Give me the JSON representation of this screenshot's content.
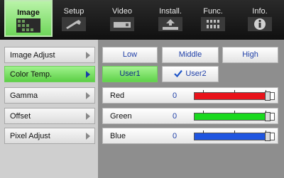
{
  "tabs": [
    {
      "label": "Image",
      "icon": "image-grid-icon",
      "active": true
    },
    {
      "label": "Setup",
      "icon": "wrench-icon",
      "active": false
    },
    {
      "label": "Video",
      "icon": "projector-icon",
      "active": false
    },
    {
      "label": "Install.",
      "icon": "install-tray-icon",
      "active": false
    },
    {
      "label": "Func.",
      "icon": "function-grid-icon",
      "active": false
    },
    {
      "label": "Info.",
      "icon": "info-icon",
      "active": false
    }
  ],
  "menu": [
    {
      "label": "Image Adjust",
      "selected": false
    },
    {
      "label": "Color Temp.",
      "selected": true
    },
    {
      "label": "Gamma",
      "selected": false
    },
    {
      "label": "Offset",
      "selected": false
    },
    {
      "label": "Pixel Adjust",
      "selected": false
    }
  ],
  "presets": {
    "low": "Low",
    "middle": "Middle",
    "high": "High"
  },
  "users": {
    "user1": "User1",
    "user2": "User2",
    "selected": "User1",
    "checked": "User2"
  },
  "sliders": [
    {
      "name": "Red",
      "value": "0",
      "level": 0.92,
      "color": "#e8121a"
    },
    {
      "name": "Green",
      "value": "0",
      "level": 0.92,
      "color": "#19d91e"
    },
    {
      "name": "Blue",
      "value": "0",
      "level": 0.92,
      "color": "#1f55e0"
    }
  ],
  "colors": {
    "accent_green": "#6fd75a",
    "label_blue": "#1f3fa8"
  }
}
